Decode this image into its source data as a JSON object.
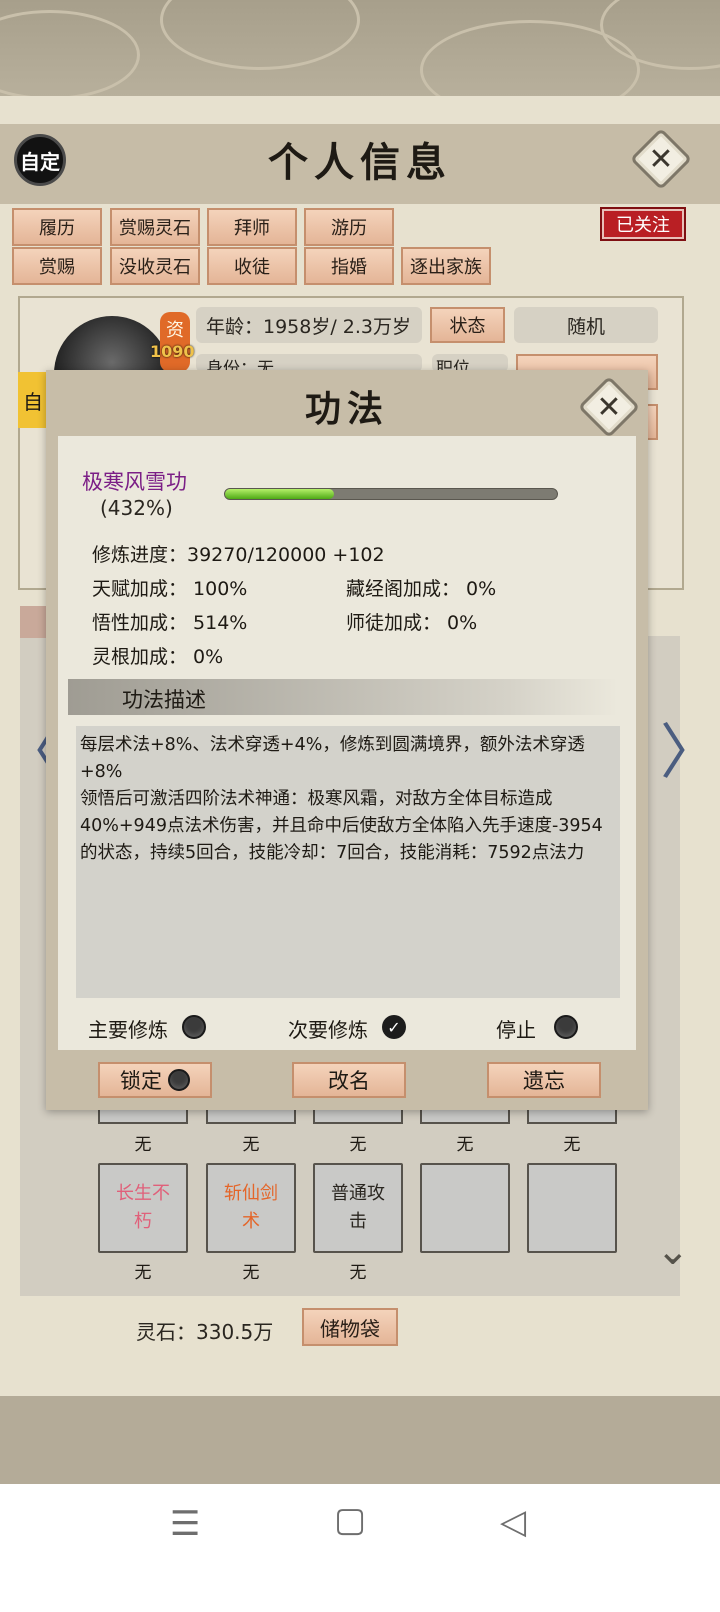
{
  "header": {
    "title": "个人信息",
    "custom_badge": "自定",
    "close_glyph": "✕"
  },
  "actions_row1": [
    "履历",
    "赏赐灵石",
    "拜师",
    "游历"
  ],
  "actions_row2": [
    "赏赐",
    "没收灵石",
    "收徒",
    "指婚",
    "逐出家族"
  ],
  "followed_label": "已关注",
  "profile": {
    "talent_chip": "资",
    "talent_value": "1090",
    "age_label": "年龄：1958岁/ 2.3万岁",
    "status_button": "状态",
    "random_button": "随机",
    "side_badge": "自",
    "identity_partial": "身份：无",
    "role_partial": "职位"
  },
  "modal": {
    "title": "功法",
    "close_glyph": "✕",
    "skill_name": "极寒风雪功",
    "skill_pct": "(432%)",
    "progress_ratio": 0.327,
    "stats": {
      "progress": "修炼进度：39270/120000  +102",
      "talent_bonus": "天赋加成：  100%",
      "library_bonus": "藏经阁加成：  0%",
      "insight_bonus": "悟性加成：  514%",
      "master_bonus": "师徒加成：     0%",
      "root_bonus": "灵根加成：  0%"
    },
    "desc_header": "功法描述",
    "desc_line1": "每层术法+8%、法术穿透+4%，修炼到圆满境界，额外法术穿透+8%",
    "desc_line2": "领悟后可激活四阶法术神通：极寒风霜，对敌方全体目标造成40%+949点法术伤害，并且命中后使敌方全体陷入先手速度-3954的状态，持续5回合，技能冷却：7回合，技能消耗：7592点法力",
    "modes": {
      "primary": "主要修炼",
      "secondary": "次要修炼",
      "stop": "停止",
      "check_glyph": "✓"
    },
    "footer": {
      "lock": "锁定",
      "rename": "改名",
      "forget": "遗忘"
    }
  },
  "slots": {
    "row1_labels": [
      "无",
      "无",
      "无",
      "无",
      "无"
    ],
    "row2": [
      {
        "name": "长生不朽",
        "label": "无",
        "color": "#e0607a"
      },
      {
        "name": "斩仙剑术",
        "label": "无",
        "color": "#e4662a"
      },
      {
        "name": "普通攻击",
        "label": "无",
        "color": "#2a2620"
      },
      {
        "name": "",
        "label": "",
        "color": "#2a2620"
      },
      {
        "name": "",
        "label": "",
        "color": "#2a2620"
      }
    ]
  },
  "bottom": {
    "spirit_stone": "灵石：330.5万",
    "storage_button": "储物袋"
  },
  "arrows": {
    "left": "〈",
    "right": "〉",
    "down": "⌄"
  },
  "nav": {
    "menu": "☰",
    "home": "▢",
    "back": "◁"
  }
}
